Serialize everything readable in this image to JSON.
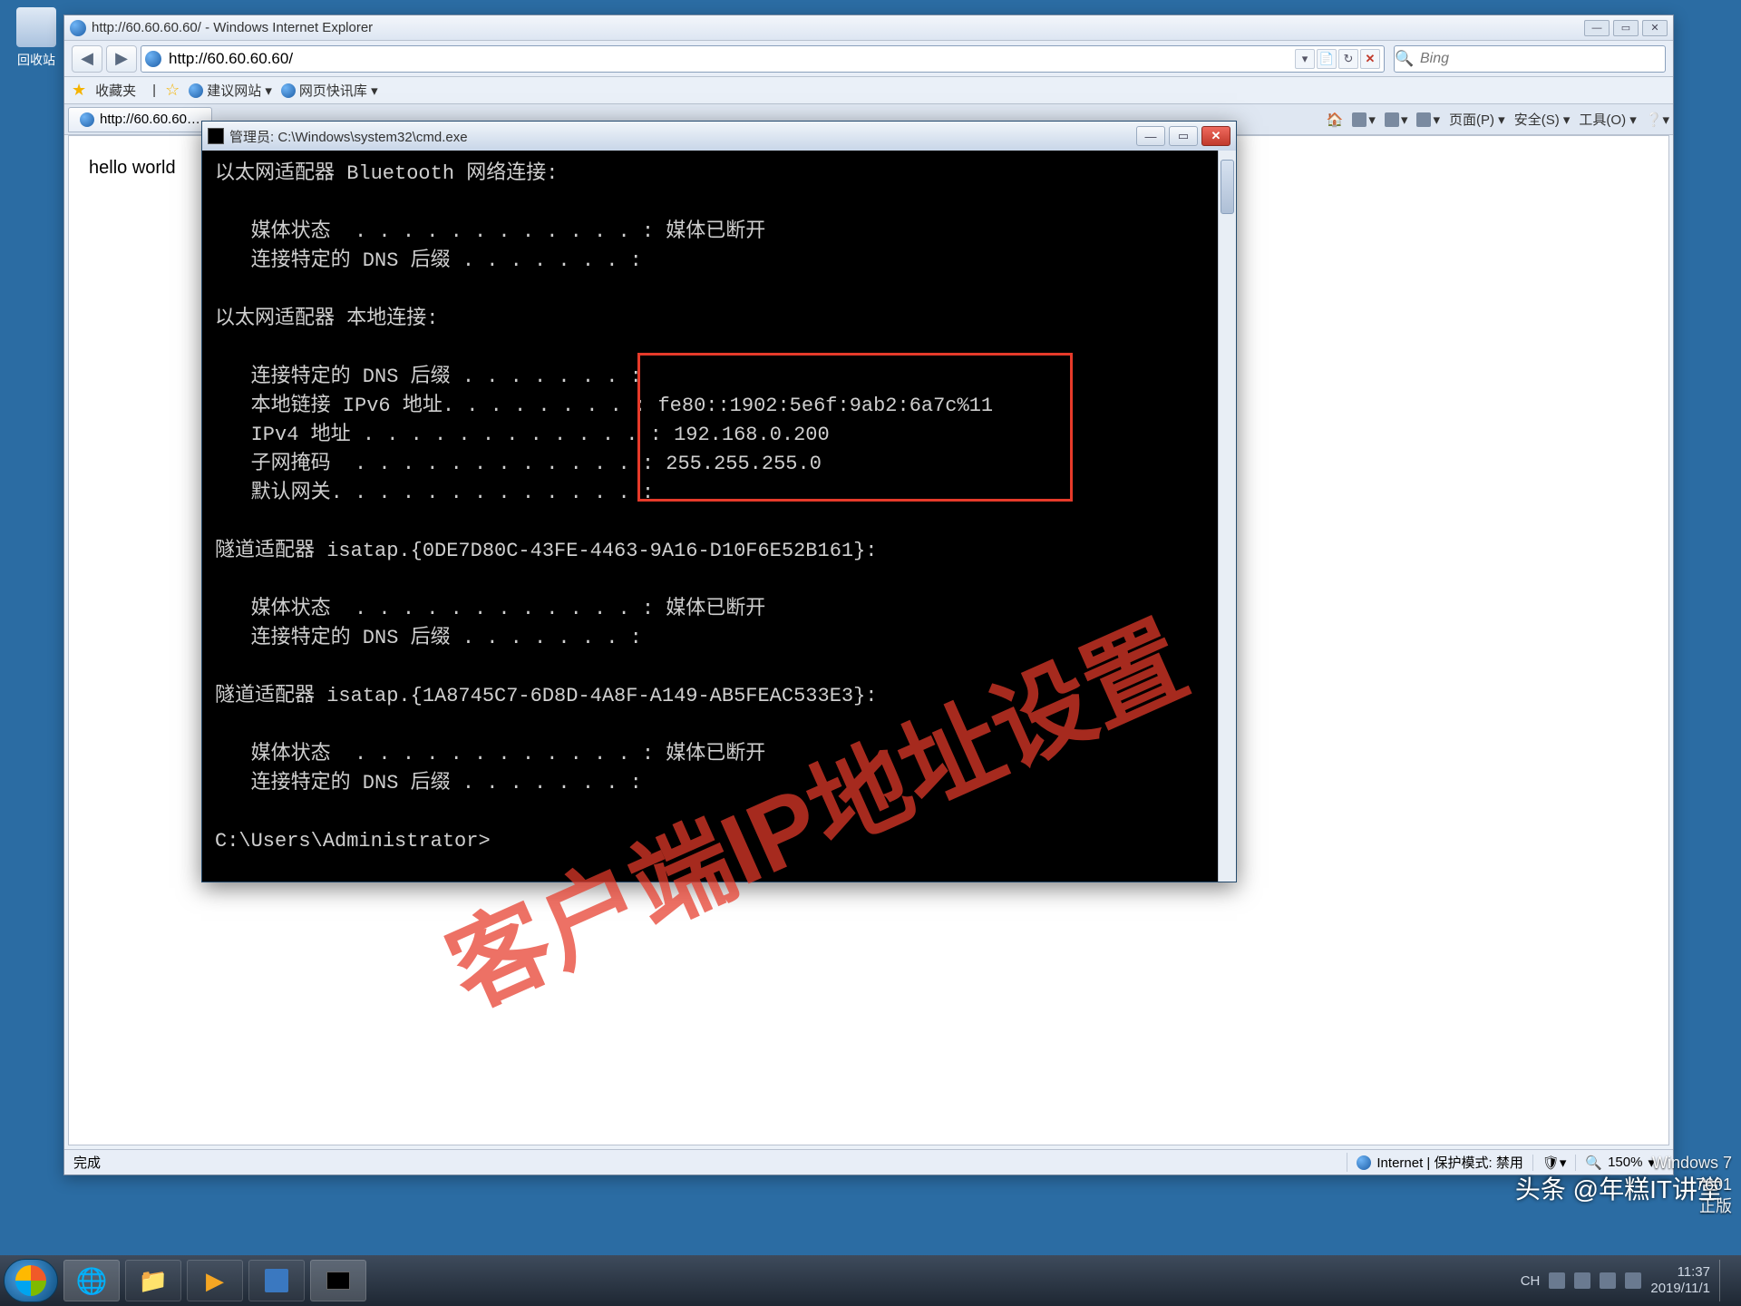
{
  "desktop": {
    "recycle_bin": "回收站"
  },
  "ie": {
    "title": "http://60.60.60.60/ - Windows Internet Explorer",
    "url": "http://60.60.60.60/",
    "search_placeholder": "Bing",
    "favorites_label": "收藏夹",
    "fav_links": {
      "suggested": "建议网站 ▾",
      "gallery": "网页快讯库 ▾"
    },
    "tab_title": "http://60.60.60…",
    "toolbar": {
      "home": "🏠",
      "feeds": "▾",
      "mail": "▾",
      "print": "▾",
      "page": "页面(P) ▾",
      "safety": "安全(S) ▾",
      "tools": "工具(O) ▾",
      "help": "❔▾"
    },
    "page_text": "hello world",
    "status_done": "完成",
    "status_zone": "Internet | 保护模式: 禁用",
    "zoom": "150%"
  },
  "cmd": {
    "title": "管理员: C:\\Windows\\system32\\cmd.exe",
    "lines": [
      "以太网适配器 Bluetooth 网络连接:",
      "",
      "   媒体状态  . . . . . . . . . . . . : 媒体已断开",
      "   连接特定的 DNS 后缀 . . . . . . . :",
      "",
      "以太网适配器 本地连接:",
      "",
      "   连接特定的 DNS 后缀 . . . . . . . :",
      "   本地链接 IPv6 地址. . . . . . . . : fe80::1902:5e6f:9ab2:6a7c%11",
      "   IPv4 地址 . . . . . . . . . . . . : 192.168.0.200",
      "   子网掩码  . . . . . . . . . . . . : 255.255.255.0",
      "   默认网关. . . . . . . . . . . . . :",
      "",
      "隧道适配器 isatap.{0DE7D80C-43FE-4463-9A16-D10F6E52B161}:",
      "",
      "   媒体状态  . . . . . . . . . . . . : 媒体已断开",
      "   连接特定的 DNS 后缀 . . . . . . . :",
      "",
      "隧道适配器 isatap.{1A8745C7-6D8D-4A8F-A149-AB5FEAC533E3}:",
      "",
      "   媒体状态  . . . . . . . . . . . . : 媒体已断开",
      "   连接特定的 DNS 后缀 . . . . . . . :",
      "",
      "C:\\Users\\Administrator>"
    ]
  },
  "watermark": {
    "text": "客户端IP地址设置",
    "credit": "头条 @年糕IT讲堂"
  },
  "brand": {
    "l1": "Windows 7",
    "l2": "7601",
    "l3": "正版"
  },
  "taskbar": {
    "tray_ime": "CH",
    "clock_time": "11:37",
    "clock_date": "2019/11/1"
  }
}
